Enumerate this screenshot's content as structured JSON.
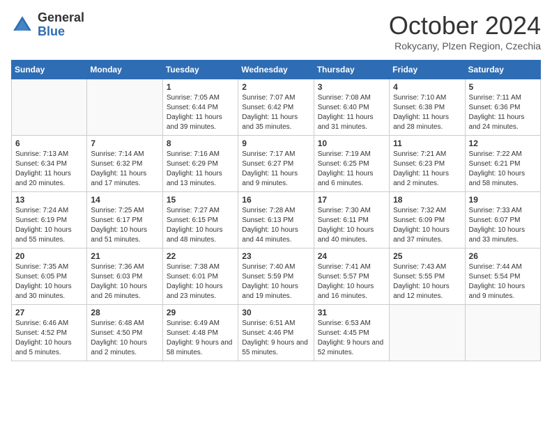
{
  "header": {
    "logo_line1": "General",
    "logo_line2": "Blue",
    "month_title": "October 2024",
    "subtitle": "Rokycany, Plzen Region, Czechia"
  },
  "days_of_week": [
    "Sunday",
    "Monday",
    "Tuesday",
    "Wednesday",
    "Thursday",
    "Friday",
    "Saturday"
  ],
  "weeks": [
    [
      {
        "day": "",
        "empty": true
      },
      {
        "day": "",
        "empty": true
      },
      {
        "day": "1",
        "sunrise": "7:05 AM",
        "sunset": "6:44 PM",
        "daylight": "11 hours and 39 minutes."
      },
      {
        "day": "2",
        "sunrise": "7:07 AM",
        "sunset": "6:42 PM",
        "daylight": "11 hours and 35 minutes."
      },
      {
        "day": "3",
        "sunrise": "7:08 AM",
        "sunset": "6:40 PM",
        "daylight": "11 hours and 31 minutes."
      },
      {
        "day": "4",
        "sunrise": "7:10 AM",
        "sunset": "6:38 PM",
        "daylight": "11 hours and 28 minutes."
      },
      {
        "day": "5",
        "sunrise": "7:11 AM",
        "sunset": "6:36 PM",
        "daylight": "11 hours and 24 minutes."
      }
    ],
    [
      {
        "day": "6",
        "sunrise": "7:13 AM",
        "sunset": "6:34 PM",
        "daylight": "11 hours and 20 minutes."
      },
      {
        "day": "7",
        "sunrise": "7:14 AM",
        "sunset": "6:32 PM",
        "daylight": "11 hours and 17 minutes."
      },
      {
        "day": "8",
        "sunrise": "7:16 AM",
        "sunset": "6:29 PM",
        "daylight": "11 hours and 13 minutes."
      },
      {
        "day": "9",
        "sunrise": "7:17 AM",
        "sunset": "6:27 PM",
        "daylight": "11 hours and 9 minutes."
      },
      {
        "day": "10",
        "sunrise": "7:19 AM",
        "sunset": "6:25 PM",
        "daylight": "11 hours and 6 minutes."
      },
      {
        "day": "11",
        "sunrise": "7:21 AM",
        "sunset": "6:23 PM",
        "daylight": "11 hours and 2 minutes."
      },
      {
        "day": "12",
        "sunrise": "7:22 AM",
        "sunset": "6:21 PM",
        "daylight": "10 hours and 58 minutes."
      }
    ],
    [
      {
        "day": "13",
        "sunrise": "7:24 AM",
        "sunset": "6:19 PM",
        "daylight": "10 hours and 55 minutes."
      },
      {
        "day": "14",
        "sunrise": "7:25 AM",
        "sunset": "6:17 PM",
        "daylight": "10 hours and 51 minutes."
      },
      {
        "day": "15",
        "sunrise": "7:27 AM",
        "sunset": "6:15 PM",
        "daylight": "10 hours and 48 minutes."
      },
      {
        "day": "16",
        "sunrise": "7:28 AM",
        "sunset": "6:13 PM",
        "daylight": "10 hours and 44 minutes."
      },
      {
        "day": "17",
        "sunrise": "7:30 AM",
        "sunset": "6:11 PM",
        "daylight": "10 hours and 40 minutes."
      },
      {
        "day": "18",
        "sunrise": "7:32 AM",
        "sunset": "6:09 PM",
        "daylight": "10 hours and 37 minutes."
      },
      {
        "day": "19",
        "sunrise": "7:33 AM",
        "sunset": "6:07 PM",
        "daylight": "10 hours and 33 minutes."
      }
    ],
    [
      {
        "day": "20",
        "sunrise": "7:35 AM",
        "sunset": "6:05 PM",
        "daylight": "10 hours and 30 minutes."
      },
      {
        "day": "21",
        "sunrise": "7:36 AM",
        "sunset": "6:03 PM",
        "daylight": "10 hours and 26 minutes."
      },
      {
        "day": "22",
        "sunrise": "7:38 AM",
        "sunset": "6:01 PM",
        "daylight": "10 hours and 23 minutes."
      },
      {
        "day": "23",
        "sunrise": "7:40 AM",
        "sunset": "5:59 PM",
        "daylight": "10 hours and 19 minutes."
      },
      {
        "day": "24",
        "sunrise": "7:41 AM",
        "sunset": "5:57 PM",
        "daylight": "10 hours and 16 minutes."
      },
      {
        "day": "25",
        "sunrise": "7:43 AM",
        "sunset": "5:55 PM",
        "daylight": "10 hours and 12 minutes."
      },
      {
        "day": "26",
        "sunrise": "7:44 AM",
        "sunset": "5:54 PM",
        "daylight": "10 hours and 9 minutes."
      }
    ],
    [
      {
        "day": "27",
        "sunrise": "6:46 AM",
        "sunset": "4:52 PM",
        "daylight": "10 hours and 5 minutes."
      },
      {
        "day": "28",
        "sunrise": "6:48 AM",
        "sunset": "4:50 PM",
        "daylight": "10 hours and 2 minutes."
      },
      {
        "day": "29",
        "sunrise": "6:49 AM",
        "sunset": "4:48 PM",
        "daylight": "9 hours and 58 minutes."
      },
      {
        "day": "30",
        "sunrise": "6:51 AM",
        "sunset": "4:46 PM",
        "daylight": "9 hours and 55 minutes."
      },
      {
        "day": "31",
        "sunrise": "6:53 AM",
        "sunset": "4:45 PM",
        "daylight": "9 hours and 52 minutes."
      },
      {
        "day": "",
        "empty": true
      },
      {
        "day": "",
        "empty": true
      }
    ]
  ],
  "labels": {
    "sunrise": "Sunrise:",
    "sunset": "Sunset:",
    "daylight": "Daylight:"
  }
}
